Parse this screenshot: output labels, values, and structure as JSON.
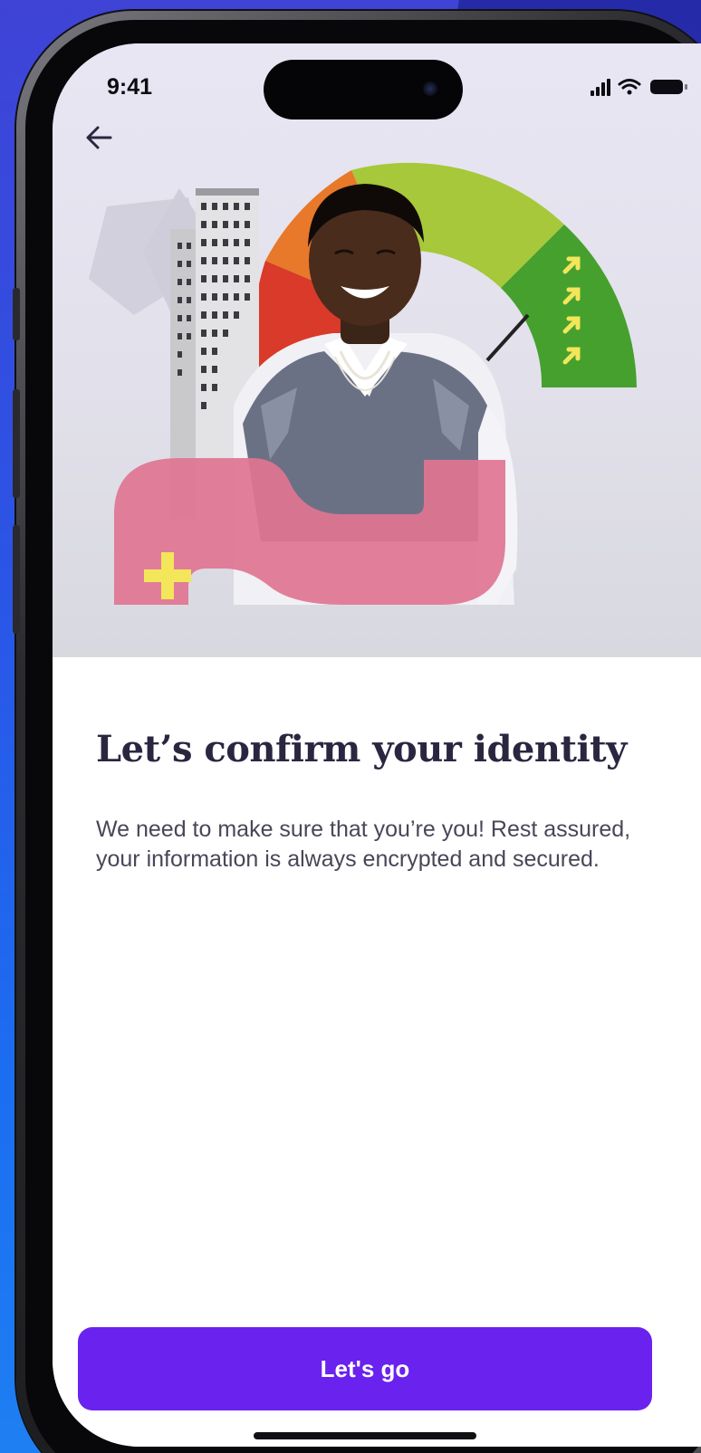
{
  "status_bar": {
    "time": "9:41",
    "icons": [
      "cellular-signal-icon",
      "wifi-icon",
      "battery-icon"
    ]
  },
  "nav": {
    "back_icon": "arrow-left-icon"
  },
  "hero": {
    "illustration": "smiling-person-with-credit-score-gauge",
    "gauge_colors": [
      "#d93a2a",
      "#e8782a",
      "#a6c83a",
      "#46a02e"
    ],
    "accent_arrow_color": "#f3e65a",
    "plus_color": "#f3e65a",
    "ribbon_color": "#e07592"
  },
  "main": {
    "title": "Let’s confirm your identity",
    "description": "We need to make sure that you’re you! Rest assured, your information is always encrypted and secured."
  },
  "actions": {
    "primary_label": "Let's go"
  },
  "colors": {
    "primary": "#6a22ee",
    "title": "#2b2640",
    "body": "#4a4658",
    "page_background": "#2a55e6"
  }
}
